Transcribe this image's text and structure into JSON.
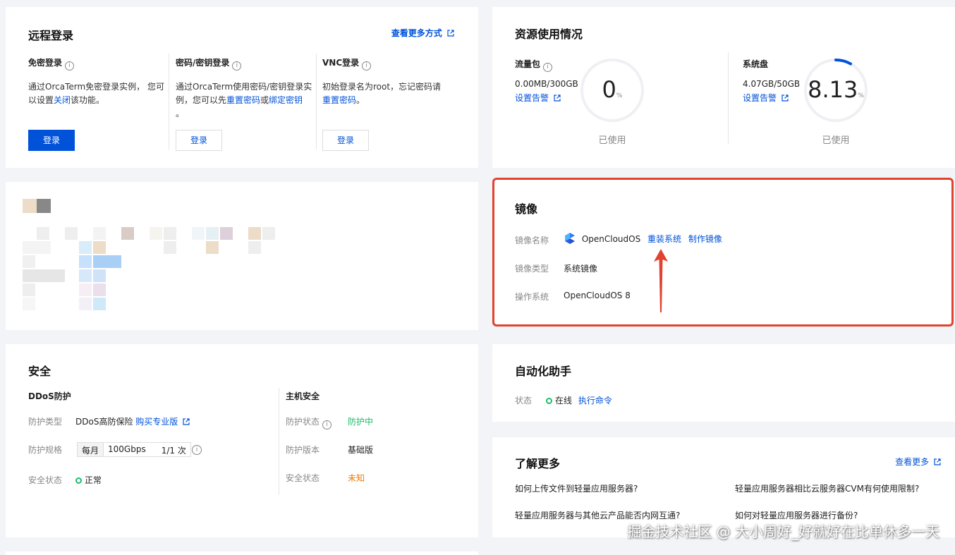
{
  "remote_login": {
    "title": "远程登录",
    "more_link": "查看更多方式",
    "cols": [
      {
        "title": "免密登录",
        "desc_a": "通过OrcaTerm免密登录实例， 您可",
        "desc_b": "以设置",
        "desc_link": "关闭",
        "desc_c": "该功能。",
        "btn": "登录"
      },
      {
        "title": "密码/密钥登录",
        "desc_a": "通过OrcaTerm使用密码/密钥登录实",
        "desc_b": "例，您可以先",
        "link1": "重置密码",
        "mid": "或",
        "link2": "绑定密钥",
        "end": "。",
        "btn": "登录"
      },
      {
        "title": "VNC登录",
        "desc_a": "初始登录名为root，忘记密码请",
        "link": "重置密码",
        "end": "。",
        "btn": "登录"
      }
    ]
  },
  "resources": {
    "title": "资源使用情况",
    "traffic": {
      "label": "流量包",
      "value": "0.00MB/300GB",
      "alert_link": "设置告警",
      "percent": "0",
      "unit": "%",
      "used_label": "已使用",
      "fraction": 0
    },
    "disk": {
      "label": "系统盘",
      "value": "4.07GB/50GB",
      "alert_link": "设置告警",
      "percent": "8.13",
      "unit": "%",
      "used_label": "已使用",
      "fraction": 0.0813
    }
  },
  "image": {
    "title": "镜像",
    "name_label": "镜像名称",
    "name_value": "OpenCloudOS",
    "reinstall_link": "重装系统",
    "make_image_link": "制作镜像",
    "type_label": "镜像类型",
    "type_value": "系统镜像",
    "os_label": "操作系统",
    "os_value": "OpenCloudOS 8",
    "highlight_color": "#e0432f"
  },
  "security": {
    "title": "安全",
    "ddos": {
      "heading": "DDoS防护",
      "type_label": "防护类型",
      "type_value": "DDoS高防保险",
      "buy_link": "购买专业版",
      "spec_label": "防护规格",
      "spec_period": "每月",
      "spec_bandwidth": "100Gbps",
      "spec_count": "1/1 次",
      "status_label": "安全状态",
      "status_value": "正常"
    },
    "host": {
      "heading": "主机安全",
      "status_label": "防护状态",
      "status_value": "防护中",
      "version_label": "防护版本",
      "version_value": "基础版",
      "safety_label": "安全状态",
      "safety_value": "未知"
    }
  },
  "automation": {
    "title": "自动化助手",
    "state_label": "状态",
    "state_value": "在线",
    "exec_link": "执行命令"
  },
  "learn_more": {
    "title": "了解更多",
    "more_link": "查看更多",
    "items": [
      "如何上传文件到轻量应用服务器?",
      "轻量应用服务器相比云服务器CVM有何使用限制?",
      "轻量应用服务器与其他云产品能否内网互通?",
      "如何对轻量应用服务器进行备份?"
    ]
  },
  "watermark": "掘金技术社区 @ 大小周好_好就好在比单休多一天",
  "colors": {
    "primary": "#0052d9",
    "success": "#19be6b",
    "warning": "#ed7b00",
    "highlight": "#e0432f"
  }
}
